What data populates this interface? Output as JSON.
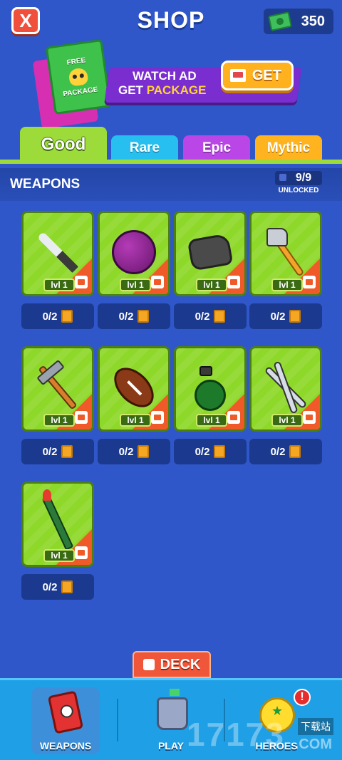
{
  "header": {
    "close_label": "X",
    "title": "SHOP",
    "currency_amount": "350"
  },
  "promo": {
    "pack_label_top": "FREE",
    "pack_label_bottom": "PACKAGE",
    "line1": "WATCH AD",
    "line2_prefix": "GET",
    "line2_highlight": "PACKAGE",
    "get_button": "GET"
  },
  "tabs": [
    {
      "label": "Good",
      "active": true
    },
    {
      "label": "Rare",
      "active": false
    },
    {
      "label": "Epic",
      "active": false
    },
    {
      "label": "Mythic",
      "active": false
    }
  ],
  "section": {
    "title": "WEAPONS",
    "unlocked_count": "9/9",
    "unlocked_label": "UNLOCKED"
  },
  "weapons": [
    {
      "icon": "knife-icon",
      "level": "lvl 1",
      "count": "0/2"
    },
    {
      "icon": "bowling-ball-icon",
      "level": "lvl 1",
      "count": "0/2"
    },
    {
      "icon": "rock-icon",
      "level": "lvl 1",
      "count": "0/2"
    },
    {
      "icon": "axe-icon",
      "level": "lvl 1",
      "count": "0/2"
    },
    {
      "icon": "hammer-icon",
      "level": "lvl 1",
      "count": "0/2"
    },
    {
      "icon": "football-icon",
      "level": "lvl 1",
      "count": "0/2"
    },
    {
      "icon": "grenade-icon",
      "level": "lvl 1",
      "count": "0/2"
    },
    {
      "icon": "scissors-icon",
      "level": "lvl 1",
      "count": "0/2"
    },
    {
      "icon": "rocket-launcher-icon",
      "level": "lvl 1",
      "count": "0/2"
    }
  ],
  "deck_button": "DECK",
  "bottom_nav": [
    {
      "label": "WEAPONS",
      "icon": "dynamite-icon",
      "active": true
    },
    {
      "label": "PLAY",
      "icon": "castle-icon",
      "active": false
    },
    {
      "label": "HEROES",
      "icon": "hero-icon",
      "active": false,
      "alert": "!"
    }
  ],
  "watermark": {
    "number": "17173",
    "chinese": "下载站",
    "suffix": ".COM"
  },
  "colors": {
    "background": "#2f57c9",
    "good_tab": "#9ddb3a",
    "rare_tab": "#27bff0",
    "epic_tab": "#bb46e8",
    "mythic_tab": "#ffb31e",
    "card_green": "#8ed82a",
    "close_red": "#ef4f3b",
    "get_orange": "#ffb21e"
  }
}
